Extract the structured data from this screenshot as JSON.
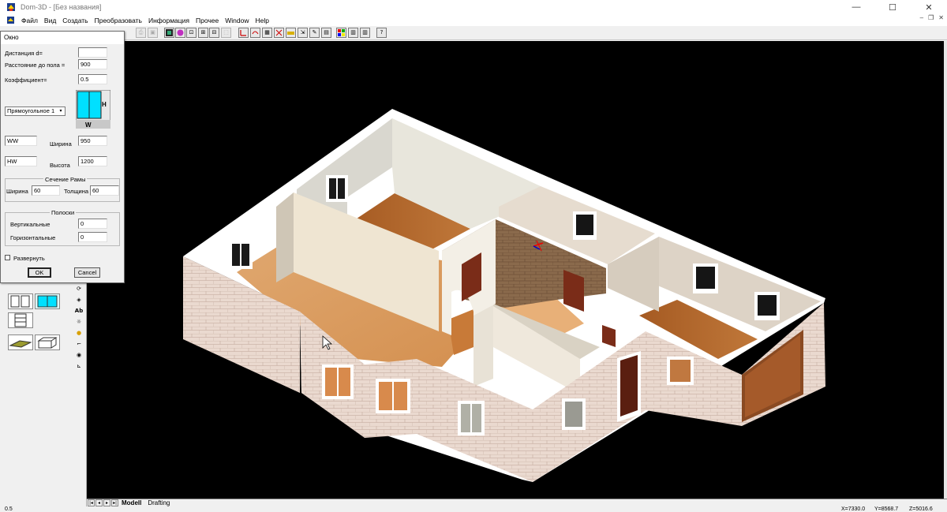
{
  "window": {
    "title": "Dom-3D - [Без названия]",
    "min_glyph": "—",
    "max_glyph": "☐",
    "close_glyph": "✕"
  },
  "menu": {
    "items": [
      "Файл",
      "Вид",
      "Создать",
      "Преобразовать",
      "Информация",
      "Прочее",
      "Window",
      "Help"
    ],
    "mdi_min": "–",
    "mdi_restore": "❐",
    "mdi_close": "✕"
  },
  "toolbar": {
    "help_label": "?"
  },
  "dialog": {
    "title": "Окно",
    "distance_label": "Дистанция d=",
    "distance_value": "",
    "floor_label": "Расстояние до пола =",
    "floor_value": "900",
    "coef_label": "Коэффициент=",
    "coef_value": "0.5",
    "shape_value": "Прямоугольное 1",
    "preview_h": "H",
    "preview_w": "W",
    "ww_value": "WW",
    "hw_value": "HW",
    "width_label": "Ширина",
    "width_value": "950",
    "height_label": "Высота",
    "height_value": "1200",
    "frame_group": "Сечение Рамы",
    "frame_width_label": "Ширина",
    "frame_width_value": "60",
    "frame_thick_label": "Толщина",
    "frame_thick_value": "60",
    "stripes_group": "Полоски",
    "vertical_label": "Вертикальные",
    "vertical_value": "0",
    "horizontal_label": "Горизонтальные",
    "horizontal_value": "0",
    "expand_label": "Развернуть",
    "expand_checked": false,
    "ok_label": "OK",
    "cancel_label": "Cancel"
  },
  "tabs": {
    "items": [
      "Modell",
      "Drafting"
    ],
    "active": "Modell"
  },
  "status": {
    "left": "0.5",
    "x": "X=7330.0",
    "y": "Y=8568.7",
    "z": "Z=5016.6"
  },
  "viewport": {
    "background": "#000000",
    "cursor_icon": "arrow-cursor-icon",
    "axis_marker_icon": "axis-marker-icon"
  },
  "colors": {
    "wall_white": "#ffffff",
    "brick_light": "#e8d6cc",
    "brick_mortar": "#c9b2a6",
    "floor_wood": "#b4662d",
    "interior_wall": "#e8dcc8",
    "accent_cyan": "#00e0ff"
  }
}
